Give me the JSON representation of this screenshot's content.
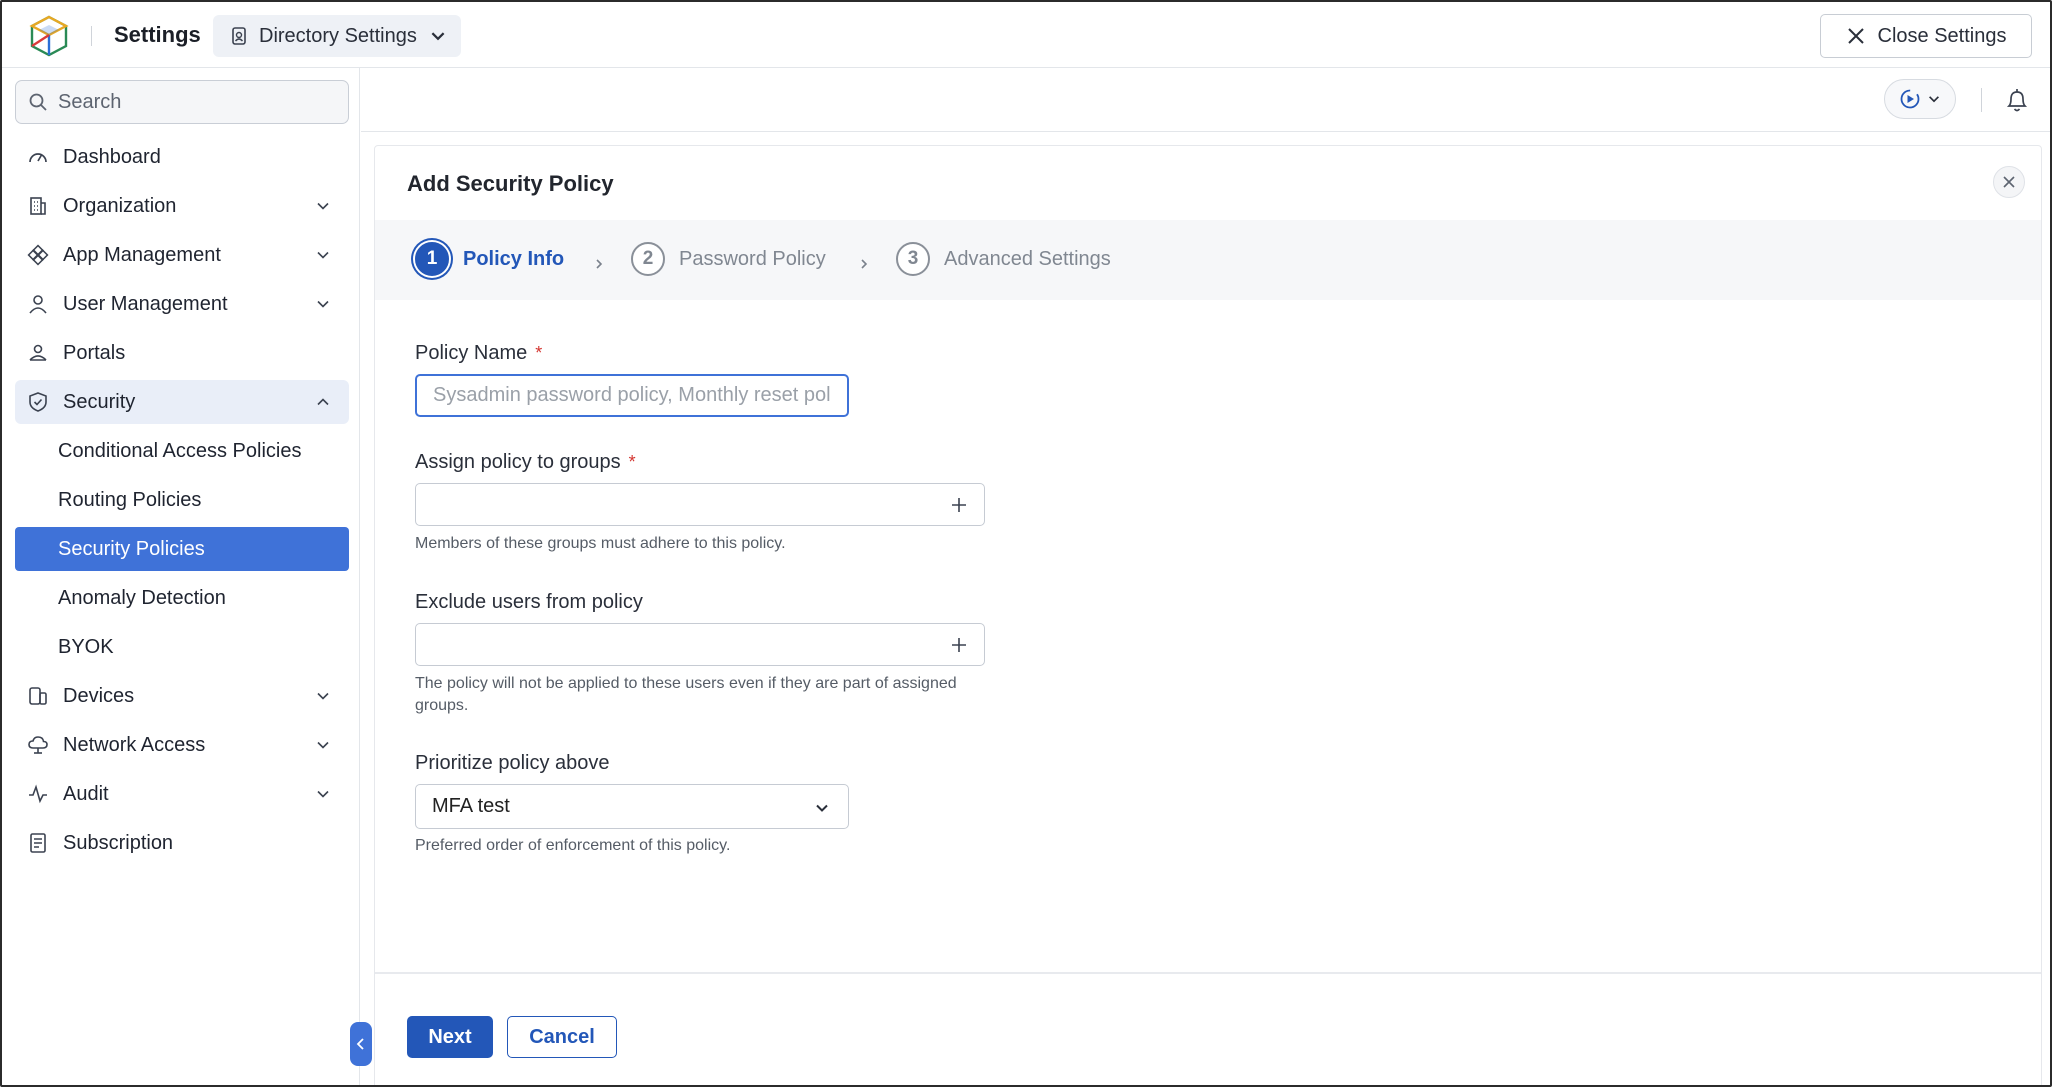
{
  "app": {
    "title": "Settings",
    "directory_button": "Directory Settings",
    "close_settings": "Close Settings"
  },
  "sidebar": {
    "search_placeholder": "Search",
    "items": [
      {
        "label": "Dashboard",
        "icon": "gauge-icon"
      },
      {
        "label": "Organization",
        "icon": "building-icon"
      },
      {
        "label": "App Management",
        "icon": "apps-icon"
      },
      {
        "label": "User Management",
        "icon": "user-icon"
      },
      {
        "label": "Portals",
        "icon": "portal-icon"
      },
      {
        "label": "Security",
        "icon": "shield-icon"
      },
      {
        "label": "Devices",
        "icon": "devices-icon"
      },
      {
        "label": "Network Access",
        "icon": "cloud-icon"
      },
      {
        "label": "Audit",
        "icon": "pulse-icon"
      },
      {
        "label": "Subscription",
        "icon": "receipt-icon"
      }
    ],
    "security_subitems": [
      "Conditional Access Policies",
      "Routing Policies",
      "Security Policies",
      "Anomaly Detection",
      "BYOK"
    ],
    "selected": "Security Policies"
  },
  "panel": {
    "title": "Add Security Policy",
    "steps": [
      {
        "num": "1",
        "label": "Policy Info"
      },
      {
        "num": "2",
        "label": "Password Policy"
      },
      {
        "num": "3",
        "label": "Advanced Settings"
      }
    ],
    "required_mark": "*",
    "fields": {
      "policy_name_label": "Policy Name",
      "policy_name_placeholder": "Sysadmin password policy, Monthly reset policy",
      "assign_label": "Assign policy to groups",
      "assign_help": "Members of these groups must adhere to this policy.",
      "exclude_label": "Exclude users from policy",
      "exclude_help": "The policy will not be applied to these users even if they are part of assigned groups.",
      "prioritize_label": "Prioritize policy above",
      "prioritize_value": "MFA test",
      "prioritize_help": "Preferred order of enforcement of this policy."
    },
    "buttons": {
      "next": "Next",
      "cancel": "Cancel"
    }
  },
  "colors": {
    "accent": "#2357b8",
    "selected_bg": "#3f72d8",
    "required": "#d3342f"
  }
}
